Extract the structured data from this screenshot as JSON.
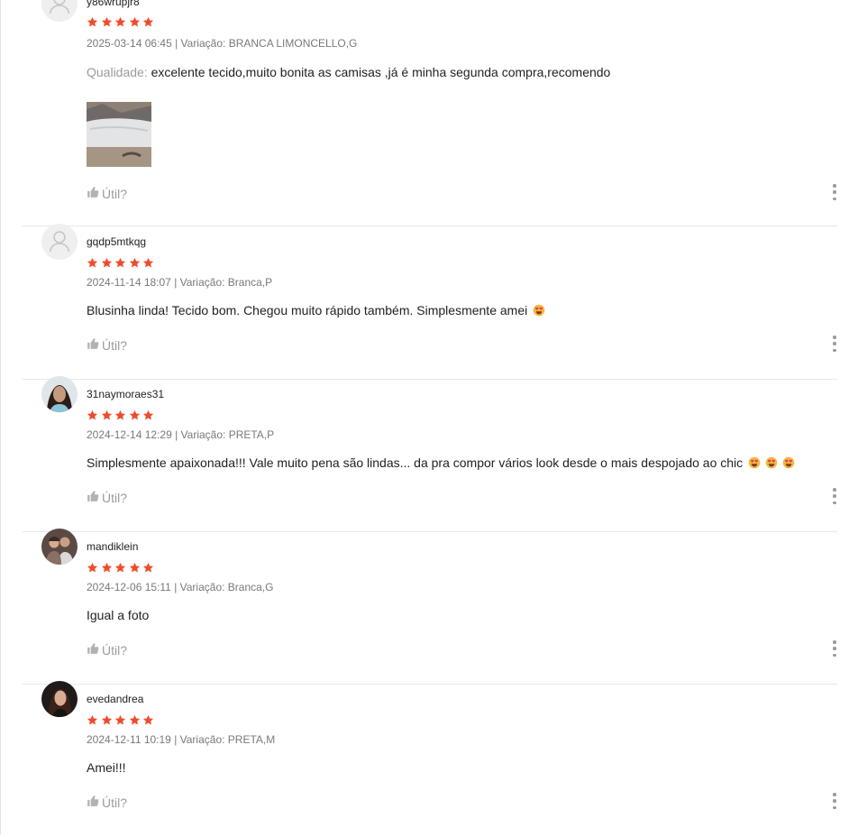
{
  "colors": {
    "star": "#ee4d2d",
    "separator": "#e8e8e8",
    "meta": "#757575"
  },
  "reviews": [
    {
      "username": "y86wrupjr8",
      "rating": 5,
      "date": "2025-03-14 06:45",
      "variation": "BRANCA LIMONCELLO,G",
      "text_label": "Qualidade:",
      "text": "excelente tecido,muito bonita as camisas ,já é minha segunda compra,recomendo",
      "emojis": 0,
      "has_photo": true,
      "avatar": "default-user-icon",
      "useful_label": "Útil?"
    },
    {
      "username": "gqdp5mtkqg",
      "rating": 5,
      "date": "2024-11-14 18:07",
      "variation": "Branca,P",
      "text_label": "",
      "text": "Blusinha linda! Tecido bom. Chegou muito rápido também. Simplesmente amei",
      "emojis": 1,
      "has_photo": false,
      "avatar": "default-user-icon",
      "useful_label": "Útil?"
    },
    {
      "username": "31naymoraes31",
      "rating": 5,
      "date": "2024-12-14 12:29",
      "variation": "PRETA,P",
      "text_label": "",
      "text": "Simplesmente apaixonada!!! Vale muito pena são lindas... da pra compor vários look desde o mais despojado ao chic",
      "emojis": 3,
      "has_photo": false,
      "avatar": "photo-woman-light",
      "useful_label": "Útil?"
    },
    {
      "username": "mandiklein",
      "rating": 5,
      "date": "2024-12-06 15:11",
      "variation": "Branca,G",
      "text_label": "",
      "text": "Igual a foto",
      "emojis": 0,
      "has_photo": false,
      "avatar": "photo-couple",
      "useful_label": "Útil?"
    },
    {
      "username": "evedandrea",
      "rating": 5,
      "date": "2024-12-11 10:19",
      "variation": "PRETA,M",
      "text_label": "",
      "text": "Amei!!!",
      "emojis": 0,
      "has_photo": false,
      "avatar": "photo-woman-dark",
      "useful_label": "Útil?"
    }
  ]
}
